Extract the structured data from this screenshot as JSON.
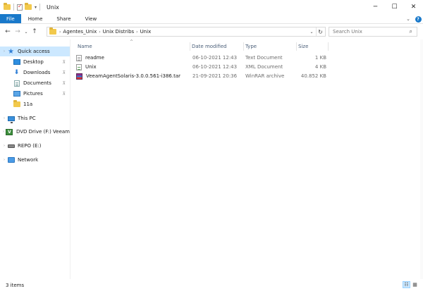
{
  "window": {
    "title": "Unix",
    "controls": {
      "minimize": "─",
      "maximize": "☐",
      "close": "✕"
    }
  },
  "quick_access_toolbar": {
    "icons": [
      "folder-icon",
      "properties-icon",
      "new-folder-icon",
      "customize-arrow-icon"
    ],
    "dropdown_glyph": "▾"
  },
  "ribbon": {
    "tabs": [
      {
        "label": "File"
      },
      {
        "label": "Home"
      },
      {
        "label": "Share"
      },
      {
        "label": "View"
      }
    ],
    "expand_glyph": "⌄",
    "help_glyph": "?"
  },
  "navigation": {
    "back": "←",
    "forward": "→",
    "recent": "⌄",
    "up": "↑"
  },
  "address_bar": {
    "crumbs": [
      "Agentes_Unix",
      "Unix Distribs",
      "Unix"
    ],
    "separator": "›",
    "dropdown_glyph": "⌄",
    "refresh_glyph": "↻"
  },
  "search": {
    "placeholder": "Search Unix",
    "glyph": "⌕"
  },
  "nav_pane": {
    "items": [
      {
        "label": "Quick access",
        "icon": "star-icon",
        "level": 0,
        "selected": true,
        "expander": "›"
      },
      {
        "label": "Desktop",
        "icon": "desktop-icon",
        "level": 1,
        "pinned": true
      },
      {
        "label": "Downloads",
        "icon": "downloads-icon",
        "level": 1,
        "pinned": true
      },
      {
        "label": "Documents",
        "icon": "documents-icon",
        "level": 1,
        "pinned": true
      },
      {
        "label": "Pictures",
        "icon": "pictures-icon",
        "level": 1,
        "pinned": true
      },
      {
        "label": "11a",
        "icon": "folder-icon",
        "level": 1,
        "pinned": false
      },
      {
        "label": "This PC",
        "icon": "computer-icon",
        "level": 0,
        "expander": "›"
      },
      {
        "label": "DVD Drive (F:) Veeam",
        "icon": "dvd-drive-icon",
        "level": 0,
        "expander": "›"
      },
      {
        "label": "REPO (E:)",
        "icon": "drive-icon",
        "level": 0,
        "expander": "›"
      },
      {
        "label": "Network",
        "icon": "network-icon",
        "level": 0,
        "expander": "›"
      }
    ],
    "pin_glyph": "📌"
  },
  "file_list": {
    "sort_glyph": "^",
    "columns": {
      "name": "Name",
      "date": "Date modified",
      "type": "Type",
      "size": "Size"
    },
    "rows": [
      {
        "name": "readme",
        "date": "06-10-2021 12:43",
        "type": "Text Document",
        "size": "1 KB",
        "icon": "text-file-icon"
      },
      {
        "name": "Unix",
        "date": "06-10-2021 12:43",
        "type": "XML Document",
        "size": "4 KB",
        "icon": "xml-file-icon"
      },
      {
        "name": "VeeamAgentSolaris-3.0.0.561-i386.tar",
        "date": "21-09-2021 20:36",
        "type": "WinRAR archive",
        "size": "40.852 KB",
        "icon": "winrar-archive-icon"
      }
    ]
  },
  "status_bar": {
    "item_count": "3 items",
    "view_glyphs": {
      "details": "☷",
      "large_icons": "▦"
    }
  },
  "colors": {
    "accent": "#1979ca",
    "selection": "#cce8ff",
    "header_text": "#4c607a",
    "folder": "#f2c94c"
  }
}
